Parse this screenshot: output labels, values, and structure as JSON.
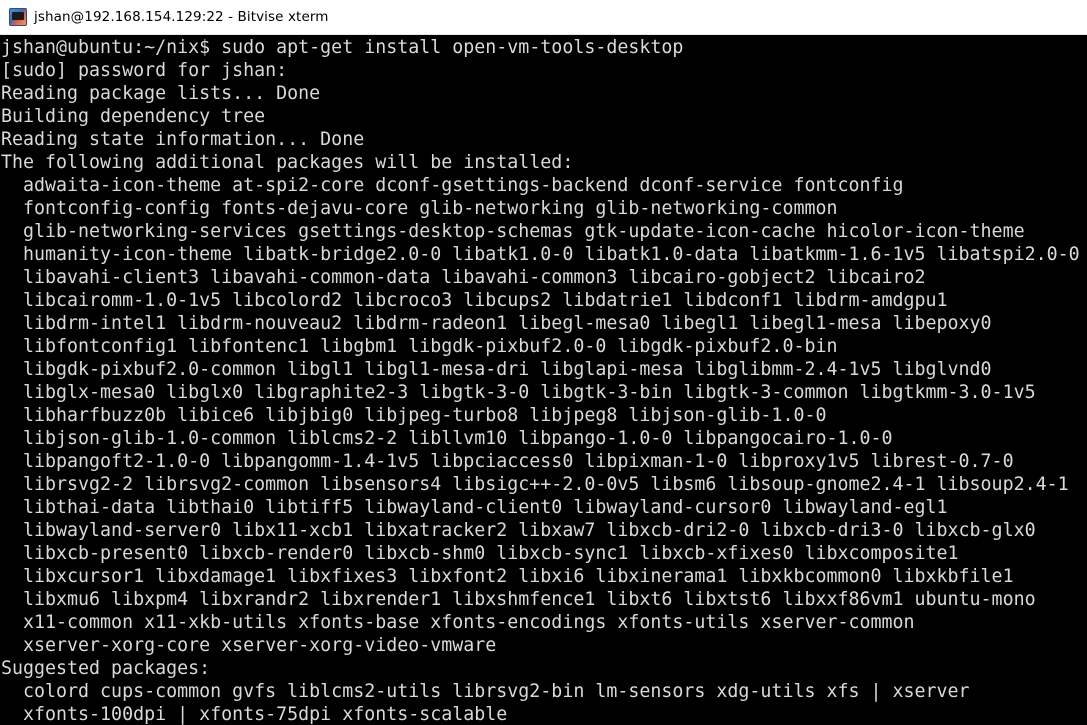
{
  "window": {
    "title": "jshan@192.168.154.129:22 - Bitvise xterm",
    "icon": "bitvise-terminal-icon"
  },
  "terminal": {
    "lines": [
      "jshan@ubuntu:~/nix$ sudo apt-get install open-vm-tools-desktop",
      "[sudo] password for jshan:",
      "Reading package lists... Done",
      "Building dependency tree",
      "Reading state information... Done",
      "The following additional packages will be installed:",
      "  adwaita-icon-theme at-spi2-core dconf-gsettings-backend dconf-service fontconfig",
      "  fontconfig-config fonts-dejavu-core glib-networking glib-networking-common",
      "  glib-networking-services gsettings-desktop-schemas gtk-update-icon-cache hicolor-icon-theme",
      "  humanity-icon-theme libatk-bridge2.0-0 libatk1.0-0 libatk1.0-data libatkmm-1.6-1v5 libatspi2.0-0",
      "  libavahi-client3 libavahi-common-data libavahi-common3 libcairo-gobject2 libcairo2",
      "  libcairomm-1.0-1v5 libcolord2 libcroco3 libcups2 libdatrie1 libdconf1 libdrm-amdgpu1",
      "  libdrm-intel1 libdrm-nouveau2 libdrm-radeon1 libegl-mesa0 libegl1 libegl1-mesa libepoxy0",
      "  libfontconfig1 libfontenc1 libgbm1 libgdk-pixbuf2.0-0 libgdk-pixbuf2.0-bin",
      "  libgdk-pixbuf2.0-common libgl1 libgl1-mesa-dri libglapi-mesa libglibmm-2.4-1v5 libglvnd0",
      "  libglx-mesa0 libglx0 libgraphite2-3 libgtk-3-0 libgtk-3-bin libgtk-3-common libgtkmm-3.0-1v5",
      "  libharfbuzz0b libice6 libjbig0 libjpeg-turbo8 libjpeg8 libjson-glib-1.0-0",
      "  libjson-glib-1.0-common liblcms2-2 libllvm10 libpango-1.0-0 libpangocairo-1.0-0",
      "  libpangoft2-1.0-0 libpangomm-1.4-1v5 libpciaccess0 libpixman-1-0 libproxy1v5 librest-0.7-0",
      "  librsvg2-2 librsvg2-common libsensors4 libsigc++-2.0-0v5 libsm6 libsoup-gnome2.4-1 libsoup2.4-1",
      "  libthai-data libthai0 libtiff5 libwayland-client0 libwayland-cursor0 libwayland-egl1",
      "  libwayland-server0 libx11-xcb1 libxatracker2 libxaw7 libxcb-dri2-0 libxcb-dri3-0 libxcb-glx0",
      "  libxcb-present0 libxcb-render0 libxcb-shm0 libxcb-sync1 libxcb-xfixes0 libxcomposite1",
      "  libxcursor1 libxdamage1 libxfixes3 libxfont2 libxi6 libxinerama1 libxkbcommon0 libxkbfile1",
      "  libxmu6 libxpm4 libxrandr2 libxrender1 libxshmfence1 libxt6 libxtst6 libxxf86vm1 ubuntu-mono",
      "  x11-common x11-xkb-utils xfonts-base xfonts-encodings xfonts-utils xserver-common",
      "  xserver-xorg-core xserver-xorg-video-vmware",
      "Suggested packages:",
      "  colord cups-common gvfs liblcms2-utils librsvg2-bin lm-sensors xdg-utils xfs | xserver",
      "  xfonts-100dpi | xfonts-75dpi xfonts-scalable"
    ]
  }
}
